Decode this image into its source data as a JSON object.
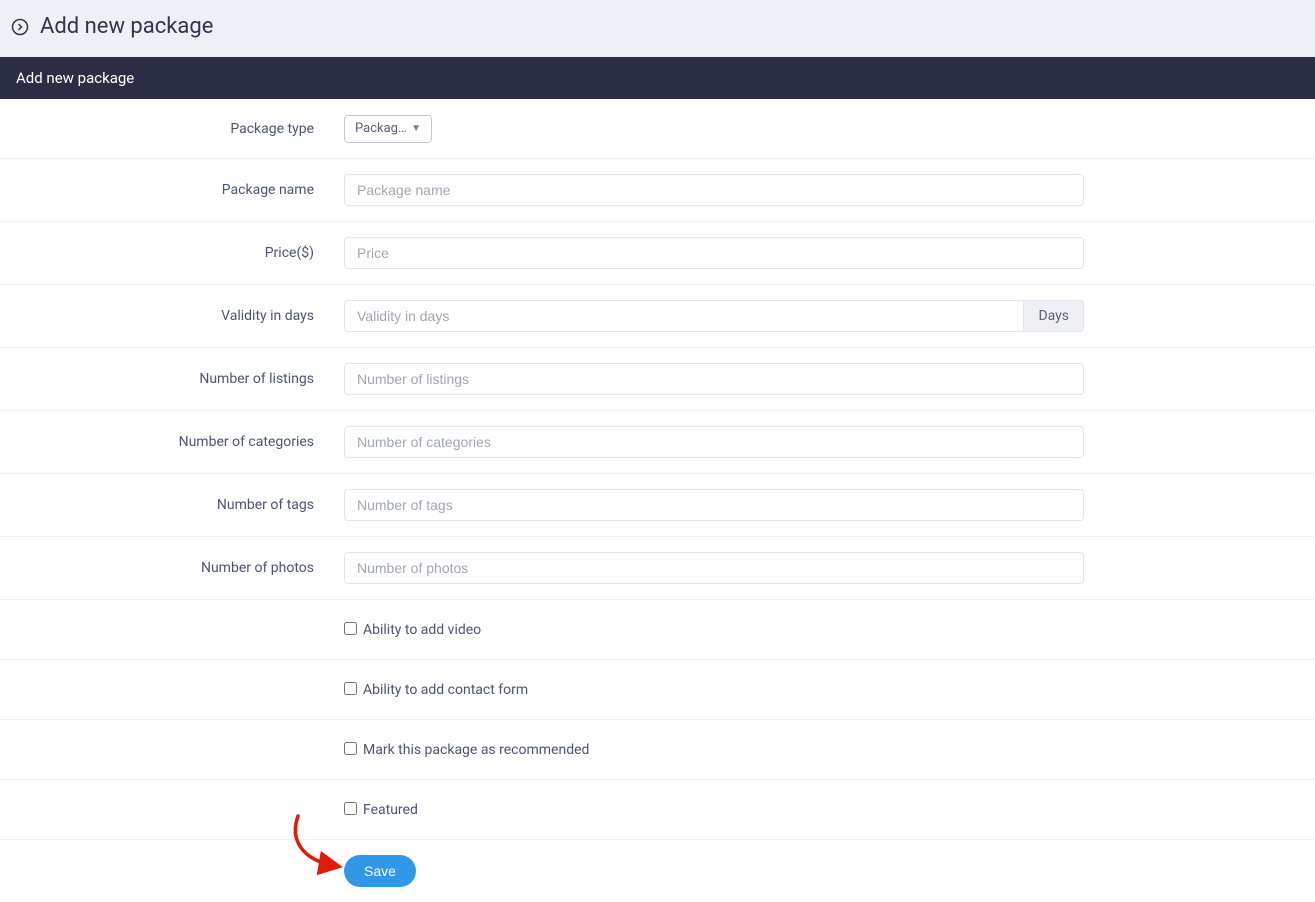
{
  "header": {
    "title": "Add new package",
    "icon": "arrow-circle-right-icon"
  },
  "section": {
    "title": "Add new package"
  },
  "form": {
    "package_type": {
      "label": "Package type",
      "selected": "Packag…"
    },
    "package_name": {
      "label": "Package name",
      "placeholder": "Package name"
    },
    "price": {
      "label": "Price($)",
      "placeholder": "Price"
    },
    "validity": {
      "label": "Validity in days",
      "placeholder": "Validity in days",
      "addon": "Days"
    },
    "num_listings": {
      "label": "Number of listings",
      "placeholder": "Number of listings"
    },
    "num_categories": {
      "label": "Number of categories",
      "placeholder": "Number of categories"
    },
    "num_tags": {
      "label": "Number of tags",
      "placeholder": "Number of tags"
    },
    "num_photos": {
      "label": "Number of photos",
      "placeholder": "Number of photos"
    },
    "ability_video": {
      "label": "Ability to add video"
    },
    "ability_contact": {
      "label": "Ability to add contact form"
    },
    "recommended": {
      "label": "Mark this package as recommended"
    },
    "featured": {
      "label": "Featured"
    },
    "save_label": "Save"
  }
}
